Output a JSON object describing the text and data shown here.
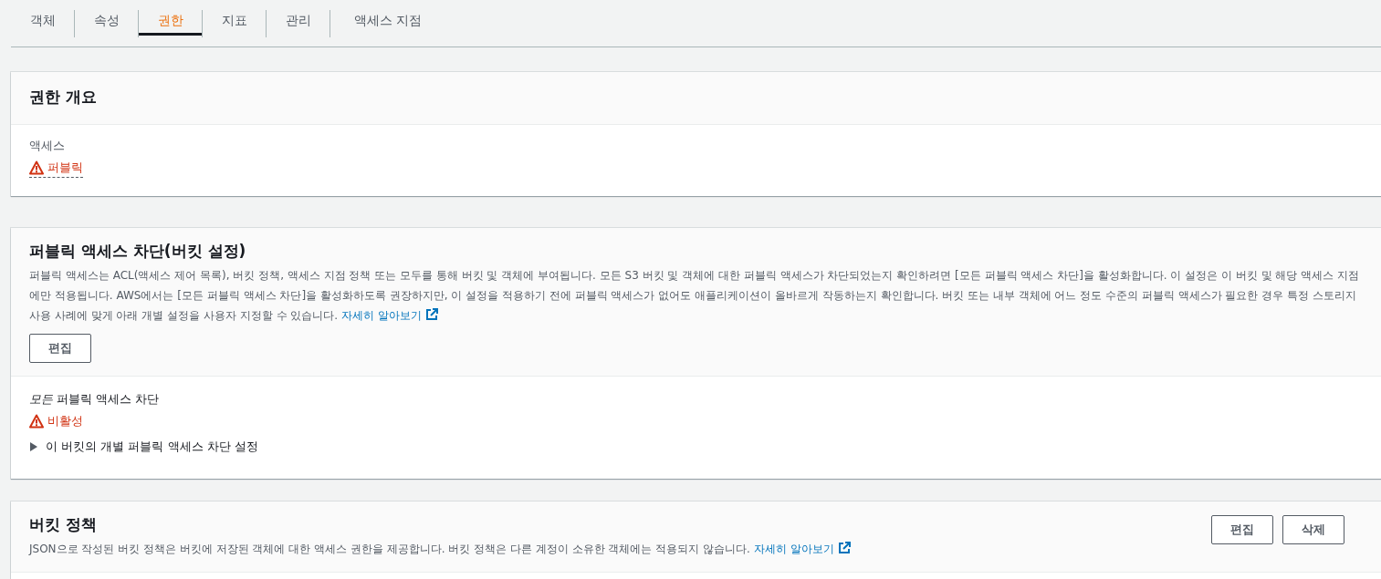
{
  "tabs": [
    {
      "label": "객체",
      "selected": false
    },
    {
      "label": "속성",
      "selected": false
    },
    {
      "label": "권한",
      "selected": true
    },
    {
      "label": "지표",
      "selected": false
    },
    {
      "label": "관리",
      "selected": false
    },
    {
      "label": "액세스 지점",
      "selected": false
    }
  ],
  "permissions_overview": {
    "title": "권한 개요",
    "access_label": "액세스",
    "access_status": {
      "kind": "warning",
      "text": "퍼블릭"
    }
  },
  "block_public_access": {
    "title": "퍼블릭 액세스 차단(버킷 설정)",
    "description": "퍼블릭 액세스는 ACL(액세스 제어 목록), 버킷 정책, 액세스 지점 정책 또는 모두를 통해 버킷 및 객체에 부여됩니다. 모든 S3 버킷 및 객체에 대한 퍼블릭 액세스가 차단되었는지 확인하려면 [모든 퍼블릭 액세스 차단]을 활성화합니다. 이 설정은 이 버킷 및 해당 액세스 지점에만 적용됩니다. AWS에서는 [모든 퍼블릭 액세스 차단]을 활성화하도록 권장하지만, 이 설정을 적용하기 전에 퍼블릭 액세스가 없어도 애플리케이션이 올바르게 작동하는지 확인합니다. 버킷 또는 내부 객체에 어느 정도 수준의 퍼블릭 액세스가 필요한 경우 특정 스토리지 사용 사례에 맞게 아래 개별 설정을 사용자 지정할 수 있습니다.",
    "learn_more": "자세히 알아보기",
    "edit_button": "편집",
    "setting_label": "*모든* 퍼블릭 액세스 차단",
    "setting_status": {
      "kind": "warning",
      "text": "비활성"
    },
    "expander": {
      "label": "이 버킷의 개별 퍼블릭 액세스 차단 설정",
      "expanded": false
    }
  },
  "bucket_policy": {
    "title": "버킷 정책",
    "description": "JSON으로 작성된 버킷 정책은 버킷에 저장된 객체에 대한 액세스 권한을 제공합니다. 버킷 정책은 다른 계정이 소유한 객체에는 적용되지 않습니다.",
    "learn_more": "자세히 알아보기",
    "buttons": [
      "편집",
      "삭제"
    ]
  }
}
